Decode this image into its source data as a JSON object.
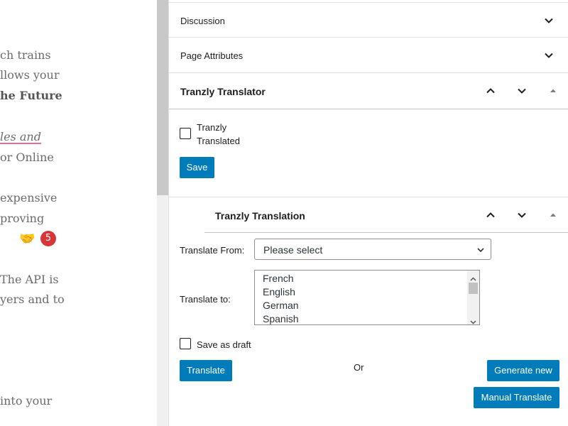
{
  "editor": {
    "lines": [
      "ch trains",
      "llows your",
      "he Future",
      "les and",
      "or Online",
      " expensive",
      "proving",
      " The API is",
      "yers and to",
      " into your"
    ],
    "badge_count": "5"
  },
  "sidebar": {
    "discussion_label": "Discussion",
    "page_attributes_label": "Page Attributes",
    "translator_title": "Tranzly Translator",
    "translated_label_1": "Tranzly",
    "translated_label_2": "Translated",
    "save_label": "Save",
    "translation_title": "Tranzly Translation",
    "translate_from_label": "Translate From:",
    "translate_from_value": "Please select",
    "translate_to_label": "Translate to:",
    "languages": [
      "French",
      "English",
      "German",
      "Spanish"
    ],
    "save_as_draft_label": "Save as draft",
    "translate_button": "Translate",
    "or_label": "Or",
    "generate_new_button": "Generate new",
    "manual_translate_button": "Manual Translate"
  },
  "colors": {
    "primary_button": "#007cba",
    "badge": "#d63638"
  }
}
